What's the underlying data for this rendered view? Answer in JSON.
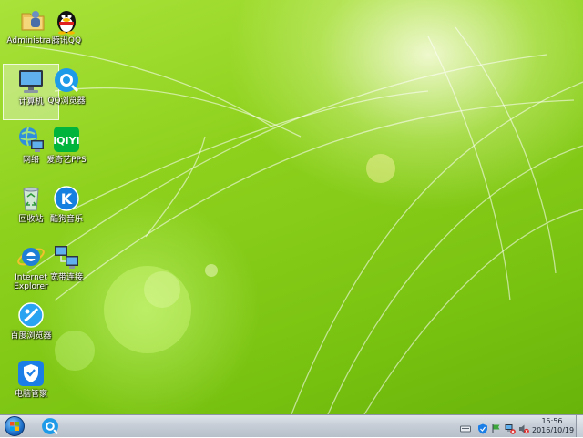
{
  "desktop": {
    "icons": [
      {
        "label": "Administra..."
      },
      {
        "label": "腾讯QQ"
      },
      {
        "label": "计算机"
      },
      {
        "label": "QQ浏览器"
      },
      {
        "label": "网络"
      },
      {
        "label": "爱奇艺PPS"
      },
      {
        "label": "回收站"
      },
      {
        "label": "酷狗音乐"
      },
      {
        "label": "Internet",
        "label2": "Explorer"
      },
      {
        "label": "宽带连接"
      },
      {
        "label": "百度浏览器"
      },
      {
        "label": "电脑管家"
      }
    ]
  },
  "taskbar": {
    "clock_time": "15:56",
    "clock_date": "2016/10/19"
  },
  "colors": {
    "wallpaper_green": "#8fd21e",
    "taskbar_gray": "#c7ced7"
  }
}
